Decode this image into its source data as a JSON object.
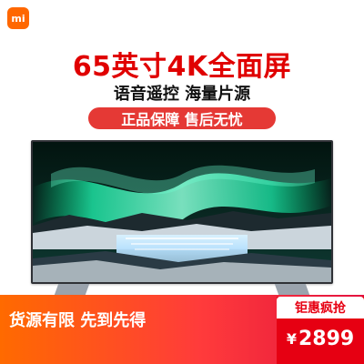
{
  "brand": {
    "logo_text": "mi",
    "accent": "#ff6700"
  },
  "headline": {
    "title": "65英寸4K全面屏",
    "subtitle": "语音遥控  海量片源",
    "guarantee": "正品保障 售后无忧"
  },
  "banner": {
    "bottom_text": "货源有限  先到先得",
    "price_tag": "钜惠疯抢",
    "price_symbol": "¥",
    "price_value": "2899"
  },
  "colors": {
    "red": "#e00000",
    "banner_red": "#e53935",
    "price_red": "#e60012",
    "tv_bezel": "#2f3136"
  }
}
